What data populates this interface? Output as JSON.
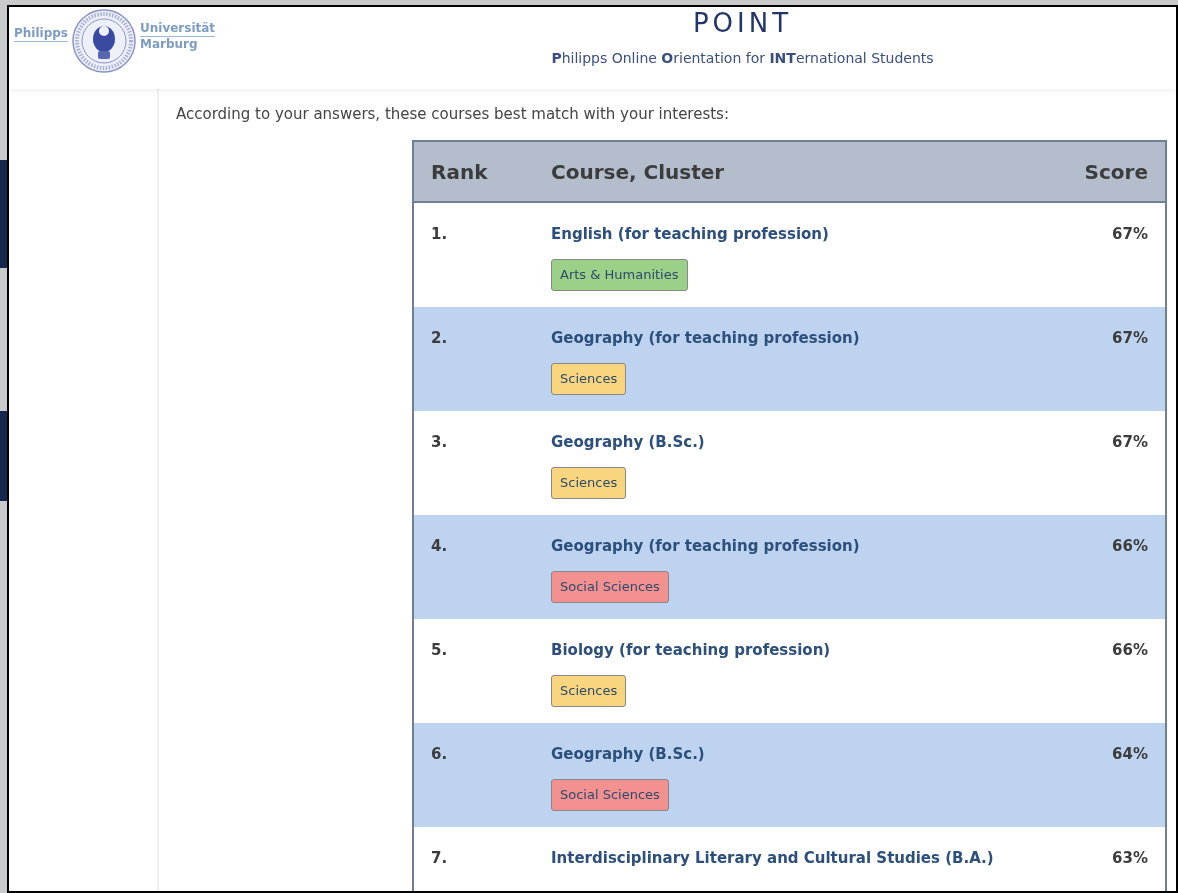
{
  "header": {
    "logo": {
      "left": "Philipps",
      "right_top": "Universität",
      "right_bottom": "Marburg"
    },
    "title": "POINT",
    "subtitle": "**P**hilipps Online **O**rientation for **INT**ernational Students"
  },
  "intro": "According to your answers, these courses best match with your interests:",
  "table": {
    "columns": [
      "Rank",
      "Course, Cluster",
      "Score"
    ],
    "rows": [
      {
        "rank": "1.",
        "course": "English (for teaching profession)",
        "score": "67%",
        "cluster": {
          "label": "Arts & Humanities",
          "color": "#9cd089"
        }
      },
      {
        "rank": "2.",
        "course": "Geography (for teaching profession)",
        "score": "67%",
        "cluster": {
          "label": "Sciences",
          "color": "#f8d57e"
        }
      },
      {
        "rank": "3.",
        "course": "Geography (B.Sc.)",
        "score": "67%",
        "cluster": {
          "label": "Sciences",
          "color": "#f8d57e"
        }
      },
      {
        "rank": "4.",
        "course": "Geography (for teaching profession)",
        "score": "66%",
        "cluster": {
          "label": "Social Sciences",
          "color": "#f39191"
        }
      },
      {
        "rank": "5.",
        "course": "Biology (for teaching profession)",
        "score": "66%",
        "cluster": {
          "label": "Sciences",
          "color": "#f8d57e"
        }
      },
      {
        "rank": "6.",
        "course": "Geography (B.Sc.)",
        "score": "64%",
        "cluster": {
          "label": "Social Sciences",
          "color": "#f39191"
        }
      },
      {
        "rank": "7.",
        "course": "Interdisciplinary Literary and Cultural Studies (B.A.)",
        "score": "63%"
      }
    ]
  }
}
